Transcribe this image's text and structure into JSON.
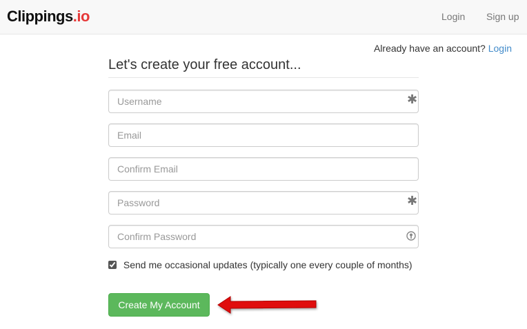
{
  "navbar": {
    "brand_main": "Clippings",
    "brand_accent": ".io",
    "login_label": "Login",
    "signup_label": "Sign up"
  },
  "account_prompt": {
    "text": "Already have an account?",
    "link_label": "Login"
  },
  "form": {
    "heading": "Let's create your free account...",
    "username_placeholder": "Username",
    "email_placeholder": "Email",
    "confirm_email_placeholder": "Confirm Email",
    "password_placeholder": "Password",
    "confirm_password_placeholder": "Confirm Password",
    "username_value": "",
    "email_value": "",
    "confirm_email_value": "",
    "password_value": "",
    "confirm_password_value": "",
    "updates_label": "Send me occasional updates (typically one every couple of months)",
    "updates_checked": true,
    "submit_label": "Create My Account"
  },
  "icons": {
    "required": "asterisk-icon",
    "password_manager": "key-icon",
    "annotation": "red-arrow-icon"
  },
  "colors": {
    "brand_accent": "#e63939",
    "link": "#428bca",
    "submit": "#5cb85c",
    "arrow": "#e01010"
  }
}
